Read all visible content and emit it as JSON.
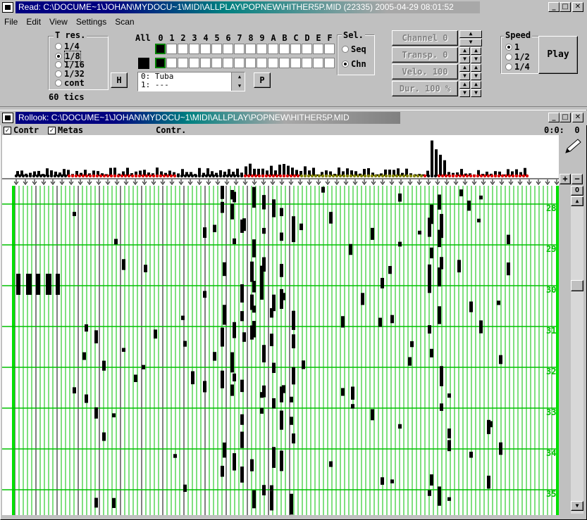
{
  "read_window": {
    "title_path": "Read: C:\\DOCUME~1\\JOHAN\\MYDOCU~1\\MIDI\\ALLPLAY\\POPNEW\\HITHER5P.MID (22335) 2005-04-29 08:01:52",
    "buttons": {
      "minimize": "_",
      "maximize": "□",
      "close": "✕"
    }
  },
  "menu": [
    "File",
    "Edit",
    "View",
    "Settings",
    "Scan"
  ],
  "tres": {
    "label": "T res.",
    "options": [
      "1/4",
      "1/8",
      "1/16",
      "1/32",
      "cont"
    ],
    "selected": "1/8",
    "tics": "60 tics"
  },
  "channels": {
    "all_label": "All",
    "headers": [
      "0",
      "1",
      "2",
      "3",
      "4",
      "5",
      "6",
      "7",
      "8",
      "9",
      "A",
      "B",
      "C",
      "D",
      "E",
      "F"
    ],
    "selected_channel": "0"
  },
  "sel": {
    "label": "Sel.",
    "options": [
      "Seq",
      "Chn"
    ],
    "selected": "Chn"
  },
  "h_button": "H",
  "p_button": "P",
  "instruments": [
    "0: Tuba",
    "1: ---"
  ],
  "controls": {
    "channel": "Channel 0",
    "transp": "Transp. 0",
    "velo": "Velo. 100",
    "dur": "Dur. 100 %"
  },
  "speed": {
    "label": "Speed",
    "options": [
      "1",
      "1/2",
      "1/4"
    ],
    "selected": "1"
  },
  "play_label": "Play",
  "rollook_window": {
    "title_path": "Rollook: C:\\DOCUME~1\\JOHAN\\MYDOCU~1\\MIDI\\ALLPLAY\\POPNEW\\HITHER5P.MID",
    "check_contr": "Contr",
    "check_metas": "Metas",
    "contr_label": "Contr.",
    "position": "0:0:  0",
    "zoom_plus": "+",
    "zoom_minus": "−",
    "o_button": "O",
    "measures": [
      "28",
      "29",
      "30",
      "31",
      "32",
      "33",
      "34",
      "35"
    ]
  },
  "colors": {
    "accent_title": "#000080",
    "grid_green": "#00c000",
    "bright_green": "#00e000",
    "note_black": "#000000",
    "marker_red": "#e00000",
    "marker_olive": "#808000"
  }
}
